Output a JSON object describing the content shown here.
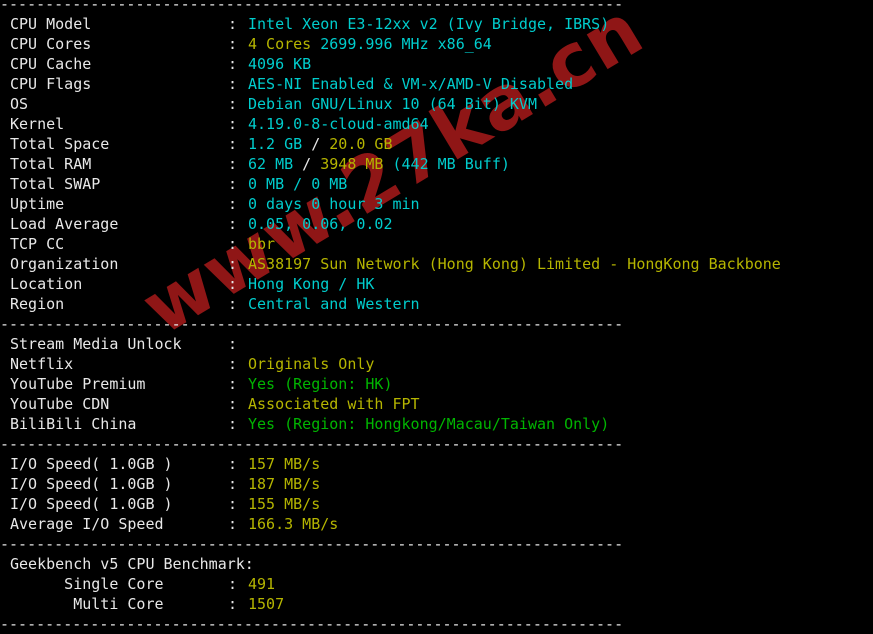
{
  "terminal": {
    "divider": "---------------------------------------------------------------------",
    "colon": ":",
    "sections": [
      {
        "id": "system-info",
        "rows": [
          {
            "label": "CPU Model",
            "parts": [
              {
                "text": "Intel Xeon E3-12xx v2 (Ivy Bridge, IBRS)",
                "color": "cyan"
              }
            ]
          },
          {
            "label": "CPU Cores",
            "parts": [
              {
                "text": "4 Cores",
                "color": "yellow"
              },
              {
                "text": " 2699.996 MHz x86_64",
                "color": "cyan"
              }
            ]
          },
          {
            "label": "CPU Cache",
            "parts": [
              {
                "text": "4096 KB",
                "color": "cyan"
              }
            ]
          },
          {
            "label": "CPU Flags",
            "parts": [
              {
                "text": "AES-NI Enabled & VM-x/AMD-V Disabled",
                "color": "cyan"
              }
            ]
          },
          {
            "label": "OS",
            "parts": [
              {
                "text": "Debian GNU/Linux 10 (64 Bit) KVM",
                "color": "cyan"
              }
            ]
          },
          {
            "label": "Kernel",
            "parts": [
              {
                "text": "4.19.0-8-cloud-amd64",
                "color": "cyan"
              }
            ]
          },
          {
            "label": "Total Space",
            "parts": [
              {
                "text": "1.2 GB",
                "color": "cyan"
              },
              {
                "text": " / ",
                "color": "white"
              },
              {
                "text": "20.0 GB",
                "color": "yellow"
              }
            ]
          },
          {
            "label": "Total RAM",
            "parts": [
              {
                "text": "62 MB",
                "color": "cyan"
              },
              {
                "text": " / ",
                "color": "white"
              },
              {
                "text": "3948 MB",
                "color": "yellow"
              },
              {
                "text": " (442 MB Buff)",
                "color": "cyan"
              }
            ]
          },
          {
            "label": "Total SWAP",
            "parts": [
              {
                "text": "0 MB / 0 MB",
                "color": "cyan"
              }
            ]
          },
          {
            "label": "Uptime",
            "parts": [
              {
                "text": "0 days 0 hour 3 min",
                "color": "cyan"
              }
            ]
          },
          {
            "label": "Load Average",
            "parts": [
              {
                "text": "0.05, 0.06, 0.02",
                "color": "cyan"
              }
            ]
          },
          {
            "label": "TCP CC",
            "parts": [
              {
                "text": "bbr",
                "color": "yellow"
              }
            ]
          },
          {
            "label": "Organization",
            "parts": [
              {
                "text": "AS38197 Sun Network (Hong Kong) Limited - HongKong Backbone",
                "color": "yellow"
              }
            ]
          },
          {
            "label": "Location",
            "parts": [
              {
                "text": "Hong Kong / HK",
                "color": "cyan"
              }
            ]
          },
          {
            "label": "Region",
            "parts": [
              {
                "text": "Central and Western",
                "color": "cyan"
              }
            ]
          }
        ]
      },
      {
        "id": "stream-media-unlock",
        "rows": [
          {
            "label": "Stream Media Unlock",
            "parts": []
          },
          {
            "label": "Netflix",
            "parts": [
              {
                "text": "Originals Only",
                "color": "yellow"
              }
            ]
          },
          {
            "label": "YouTube Premium",
            "parts": [
              {
                "text": "Yes (Region: HK)",
                "color": "green"
              }
            ]
          },
          {
            "label": "YouTube CDN",
            "parts": [
              {
                "text": "Associated with FPT",
                "color": "yellow"
              }
            ]
          },
          {
            "label": "BiliBili China",
            "parts": [
              {
                "text": "Yes (Region: Hongkong/Macau/Taiwan Only)",
                "color": "green"
              }
            ]
          }
        ]
      },
      {
        "id": "io-speed",
        "rows": [
          {
            "label": "I/O Speed( 1.0GB )",
            "parts": [
              {
                "text": "157 MB/s",
                "color": "yellow"
              }
            ]
          },
          {
            "label": "I/O Speed( 1.0GB )",
            "parts": [
              {
                "text": "187 MB/s",
                "color": "yellow"
              }
            ]
          },
          {
            "label": "I/O Speed( 1.0GB )",
            "parts": [
              {
                "text": "155 MB/s",
                "color": "yellow"
              }
            ]
          },
          {
            "label": "Average I/O Speed",
            "parts": [
              {
                "text": "166.3 MB/s",
                "color": "yellow"
              }
            ]
          }
        ]
      },
      {
        "id": "geekbench",
        "heading": "Geekbench v5 CPU Benchmark:",
        "rows": [
          {
            "label": "      Single Core",
            "parts": [
              {
                "text": "491",
                "color": "yellow"
              }
            ]
          },
          {
            "label": "       Multi Core",
            "parts": [
              {
                "text": "1507",
                "color": "yellow"
              }
            ]
          }
        ]
      }
    ]
  },
  "watermark": {
    "text": "www.27ka.cn",
    "color": "#8f1616"
  },
  "colors": {
    "background": "#000000",
    "foreground": "#e8e8e8",
    "cyan": "#00cdcd",
    "yellow": "#b5b500",
    "green": "#00b500",
    "watermark_red": "#8f1616"
  }
}
